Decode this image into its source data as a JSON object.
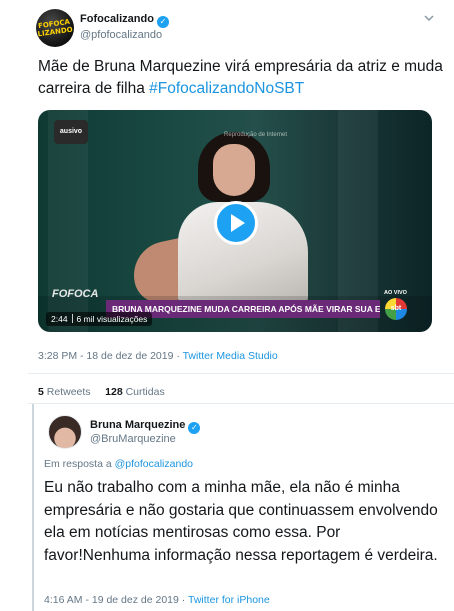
{
  "tweet": {
    "author_name": "Fofocalizando",
    "author_handle": "@pfofocalizando",
    "avatar_text_top": "FOFOCA",
    "avatar_text_bottom": "LIZANDO",
    "text": "Mãe de Bruna Marquezine virá empresária da atriz e muda carreira de filha ",
    "hashtag": "#FofocalizandoNoSBT",
    "timestamp": "3:28 PM - 18 de dez de 2019",
    "source": "Twitter Media Studio",
    "source_sep": " · ",
    "retweets_count": "5",
    "retweets_label": "Retweets",
    "likes_count": "128",
    "likes_label": "Curtidas",
    "verified_mark": "✓",
    "menu_icon": "chevron-down-icon"
  },
  "video": {
    "badge": "ausivo",
    "watermark": "Reprodução de Internet",
    "logo_text": "FOFOCA",
    "headline": "BRUNA MARQUEZINE MUDA CARREIRA APÓS MÃE VIRAR SUA EMPRESÁRIA",
    "live_label": "AO VIVO",
    "network": "sbt",
    "duration": "2:44",
    "views": "6 mil visualizações",
    "play_color": "#1da1f2"
  },
  "quoted": {
    "author_name": "Bruna Marquezine",
    "author_handle": "@BruMarquezine",
    "verified_mark": "✓",
    "reply_prefix": "Em resposta a ",
    "reply_to": "@pfofocalizando",
    "text": "Eu não trabalho com a minha mãe, ela não é minha empresária e não gostaria que continuassem envolvendo ela em notícias mentirosas como essa. Por favor!Nenhuma informação nessa reportagem é verdeira.",
    "timestamp": "4:16 AM - 19 de dez de 2019",
    "source": "Twitter for iPhone",
    "source_sep": " · "
  },
  "colors": {
    "link": "#1b95e0",
    "verified": "#1da1f2",
    "muted": "#657786",
    "headline_bar": "#6b2a78"
  }
}
